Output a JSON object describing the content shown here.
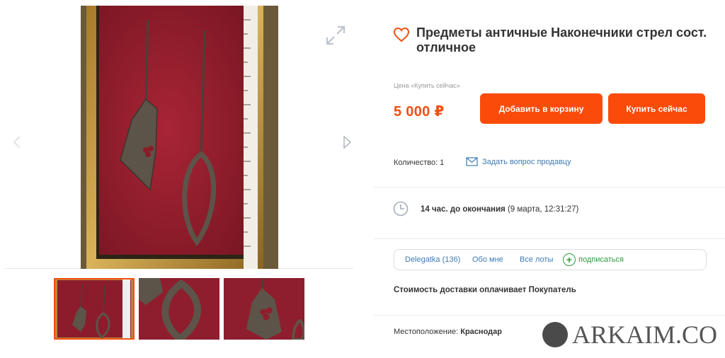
{
  "gallery": {
    "icons": {
      "prev": "chevron-left-icon",
      "next": "chevron-right-icon",
      "expand": "expand-icon"
    },
    "thumbnails": [
      "thumb-1",
      "thumb-2",
      "thumb-3"
    ],
    "active_thumbnail": 0
  },
  "lot": {
    "title": "Предметы античные Наконечники стрел сост. отличное",
    "favorite_icon": "heart-icon",
    "price_caption": "Цена «Купить сейчас»",
    "price": "5 000 ₽",
    "add_to_cart_label": "Добавить в корзину",
    "buy_now_label": "Купить сейчас",
    "quantity_label": "Количество: 1",
    "ask_seller_label": "Задать вопрос продавцу",
    "time_left": "14 час. до окончания",
    "end_date": "(9 марта, 12:31:27)",
    "delivery_text": "Стоимость доставки оплачивает Покупатель",
    "location_label": "Местоположение:",
    "location_value": "Краснодар"
  },
  "seller": {
    "name": "Delegatka (136)",
    "about_label": "Обо мне",
    "all_lots_label": "Все лоты",
    "subscribe_label": "подписаться"
  },
  "watermark": {
    "text": "ARKAIM.CO"
  },
  "colors": {
    "accent": "#fb4b0a",
    "price": "#f14f12",
    "link": "#3d7bb6",
    "subscribe": "#2e9c3b",
    "felt": "#9b1f2c",
    "frame": "#b58a3a"
  }
}
